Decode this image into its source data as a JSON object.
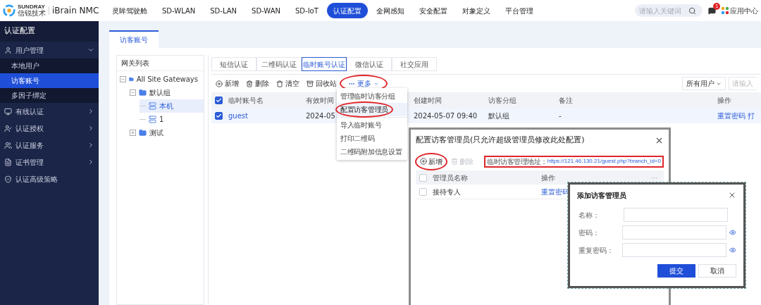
{
  "header": {
    "brand_top": "SUNDRAY",
    "brand_bottom": "信锐技术",
    "product": "iBrain NMC",
    "nav": [
      {
        "label": "灵眸驾驶舱",
        "selected": false
      },
      {
        "label": "SD-WLAN",
        "selected": false
      },
      {
        "label": "SD-LAN",
        "selected": false
      },
      {
        "label": "SD-WAN",
        "selected": false
      },
      {
        "label": "SD-IoT",
        "selected": false
      },
      {
        "label": "认证配置",
        "selected": true
      },
      {
        "label": "全网感知",
        "selected": false
      },
      {
        "label": "安全配置",
        "selected": false
      },
      {
        "label": "对象定义",
        "selected": false
      },
      {
        "label": "平台管理",
        "selected": false
      }
    ],
    "search": {
      "placeholder": "请输入关键词"
    },
    "notification_count": "1",
    "app_center": "应用中心"
  },
  "sidebar": {
    "title": "认证配置",
    "items": [
      {
        "label": "用户管理",
        "kind": "user",
        "expanded": true,
        "children": [
          {
            "label": "本地用户",
            "selected": false
          },
          {
            "label": "访客账号",
            "selected": true
          },
          {
            "label": "多因子绑定",
            "selected": false
          }
        ]
      },
      {
        "label": "有线认证",
        "kind": "wired",
        "expanded": false
      },
      {
        "label": "认证授权",
        "kind": "grant",
        "expanded": false
      },
      {
        "label": "认证服务",
        "kind": "service",
        "expanded": false
      },
      {
        "label": "证书管理",
        "kind": "cert",
        "expanded": false
      },
      {
        "label": "认证高级策略",
        "kind": "policy"
      }
    ]
  },
  "page_tab": "访客账号",
  "gateways": {
    "title": "网关列表",
    "tree": [
      {
        "label": "All Site Gateways",
        "kind": "folder",
        "expanded": true,
        "children": [
          {
            "label": "默认组",
            "kind": "folder",
            "expanded": true,
            "children": [
              {
                "label": "本机",
                "kind": "device",
                "selected": true
              },
              {
                "label": "1",
                "kind": "device",
                "selected": false
              }
            ]
          },
          {
            "label": "测试",
            "kind": "folder",
            "expanded": false
          }
        ]
      }
    ]
  },
  "auth_tabs": [
    {
      "label": "短信认证",
      "selected": false
    },
    {
      "label": "二维码认证",
      "selected": false
    },
    {
      "label": "临时账号认证",
      "selected": true
    },
    {
      "label": "微信认证",
      "selected": false
    },
    {
      "label": "社交应用",
      "selected": false
    }
  ],
  "toolbar": [
    {
      "label": "新增",
      "kind": "add",
      "annotated": false
    },
    {
      "label": "删除",
      "kind": "delete",
      "annotated": false
    },
    {
      "label": "清空",
      "kind": "clear",
      "annotated": false
    },
    {
      "label": "回收站",
      "kind": "recycle",
      "annotated": false
    },
    {
      "label": "更多",
      "kind": "more",
      "annotated": true
    }
  ],
  "filter": {
    "value": "所有用户",
    "placeholder": "请输入"
  },
  "table": {
    "all_checked": true,
    "columns": [
      "临时账号名",
      "有效时间",
      "创建时间",
      "访客分组",
      "备注",
      "操作"
    ],
    "rows": [
      {
        "checked": true,
        "cells": [
          "guest",
          "2024-05",
          "2024-05-07 09:40",
          "默认组",
          "-"
        ],
        "actions": [
          "重置密码",
          "打"
        ]
      }
    ]
  },
  "more_menu": [
    {
      "label": "管理临时访客分组",
      "selected": false,
      "annotated": false
    },
    {
      "label": "配置访客管理员",
      "selected": true,
      "annotated": true
    },
    {
      "label": "导入临时账号",
      "selected": false,
      "annotated": false
    },
    {
      "label": "打印二维码",
      "selected": false,
      "annotated": false
    },
    {
      "label": "二维码附加信息设置",
      "selected": false,
      "annotated": false
    }
  ],
  "admin_dialog": {
    "title": "配置访客管理员(只允许超级管理员修改此处配置)",
    "buttons": [
      {
        "label": "新增",
        "kind": "add",
        "disabled": false,
        "annotated": true
      },
      {
        "label": "删除",
        "kind": "delete",
        "disabled": true,
        "annotated": false
      }
    ],
    "address_label": "临时访客管理地址：",
    "address": "https://121.46.130.21/guest.php?branch_id=0",
    "all_checked": false,
    "columns": [
      "管理员名称",
      "操作",
      "···"
    ],
    "rows": [
      {
        "checked": false,
        "name": "接待专人",
        "action": "重置密码"
      }
    ]
  },
  "add_dialog": {
    "title": "添加访客管理员",
    "fields": [
      {
        "label": "名称：",
        "kind": "text"
      },
      {
        "label": "密码：",
        "kind": "password"
      },
      {
        "label": "重复密码：",
        "kind": "password"
      }
    ],
    "submit": "提交",
    "cancel": "取消"
  }
}
